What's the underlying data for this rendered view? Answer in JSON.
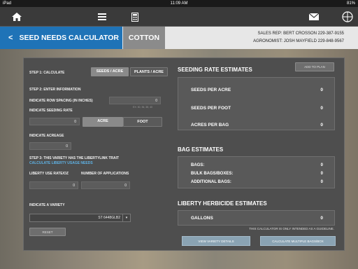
{
  "status": {
    "carrier": "iPad",
    "time": "11:09 AM",
    "battery": "81%"
  },
  "nav": {
    "home_icon": "home-icon",
    "menu_icon": "menu-icon",
    "calc_icon": "calculator-icon",
    "mail_icon": "mail-icon",
    "logo_icon": "bayer-logo-icon"
  },
  "header": {
    "back_symbol": "<",
    "title": "SEED NEEDS CALCULATOR",
    "crop": "COTTON",
    "sales_rep": "SALES REP: BERT CROSSON 229-387-9155",
    "agronomist": "AGRONOMIST: JOSH MAYFIELD 229-848-9567"
  },
  "left": {
    "step1": "STEP 1: CALCULATE",
    "seeds_acre": "SEEDS / ACRE",
    "plants_acre": "PLANTS / ACRE",
    "step2": "STEP 2: ENTER INFORMATION",
    "row_spacing_label": "INDICATE ROW SPACING (IN INCHES)",
    "row_spacing_value": "0",
    "row_spacing_hint": "EX: 30, 36, 38, 40",
    "seeding_rate_label": "INDICATE SEEDING RATE",
    "seeding_rate_value": "0",
    "acre": "ACRE",
    "foot": "FOOT",
    "acreage_label": "INDICATE ACREAGE",
    "acreage_value": "0",
    "step3": "STEP 3: THIS VARIETY HAS THE LIBERTYLINK TRAIT",
    "calc_liberty": "CALCULATE LIBERTY USAGE NEEDS",
    "liberty_rate_label": "LIBERTY USE RATE/OZ",
    "applications_label": "NUMBER OF APPLICATIONS",
    "liberty_rate_value": "0",
    "applications_value": "0",
    "variety_label": "INDICATE A VARIETY",
    "variety_value": "ST 6448GLB2",
    "reset": "RESET"
  },
  "right": {
    "seeding_title": "SEEDING RATE ESTIMATES",
    "add_to_plan": "ADD TO PLAN",
    "seeds_per_acre": "SEEDS PER ACRE",
    "seeds_per_acre_value": "0",
    "seeds_per_foot": "SEEDS PER FOOT",
    "seeds_per_foot_value": "0",
    "acres_per_bag": "ACRES PER BAG",
    "acres_per_bag_value": "0",
    "bag_title": "BAG ESTIMATES",
    "bags": "BAGS:",
    "bags_value": "0",
    "bulk": "BULK BAGS/BOXES:",
    "bulk_value": "0",
    "additional": "ADDITIONAL BAGS:",
    "additional_value": "0",
    "liberty_title": "LIBERTY HERBICIDE ESTIMATES",
    "gallons": "GALLONS",
    "gallons_value": "0",
    "disclaimer": "THIS CALCULATOR IS ONLY INTENDED AS A GUIDELINE.",
    "view_variety": "VIEW VARIETY DETAILS",
    "calc_multiple": "CALCULATE MULTIPLE BAGS/BOX"
  }
}
